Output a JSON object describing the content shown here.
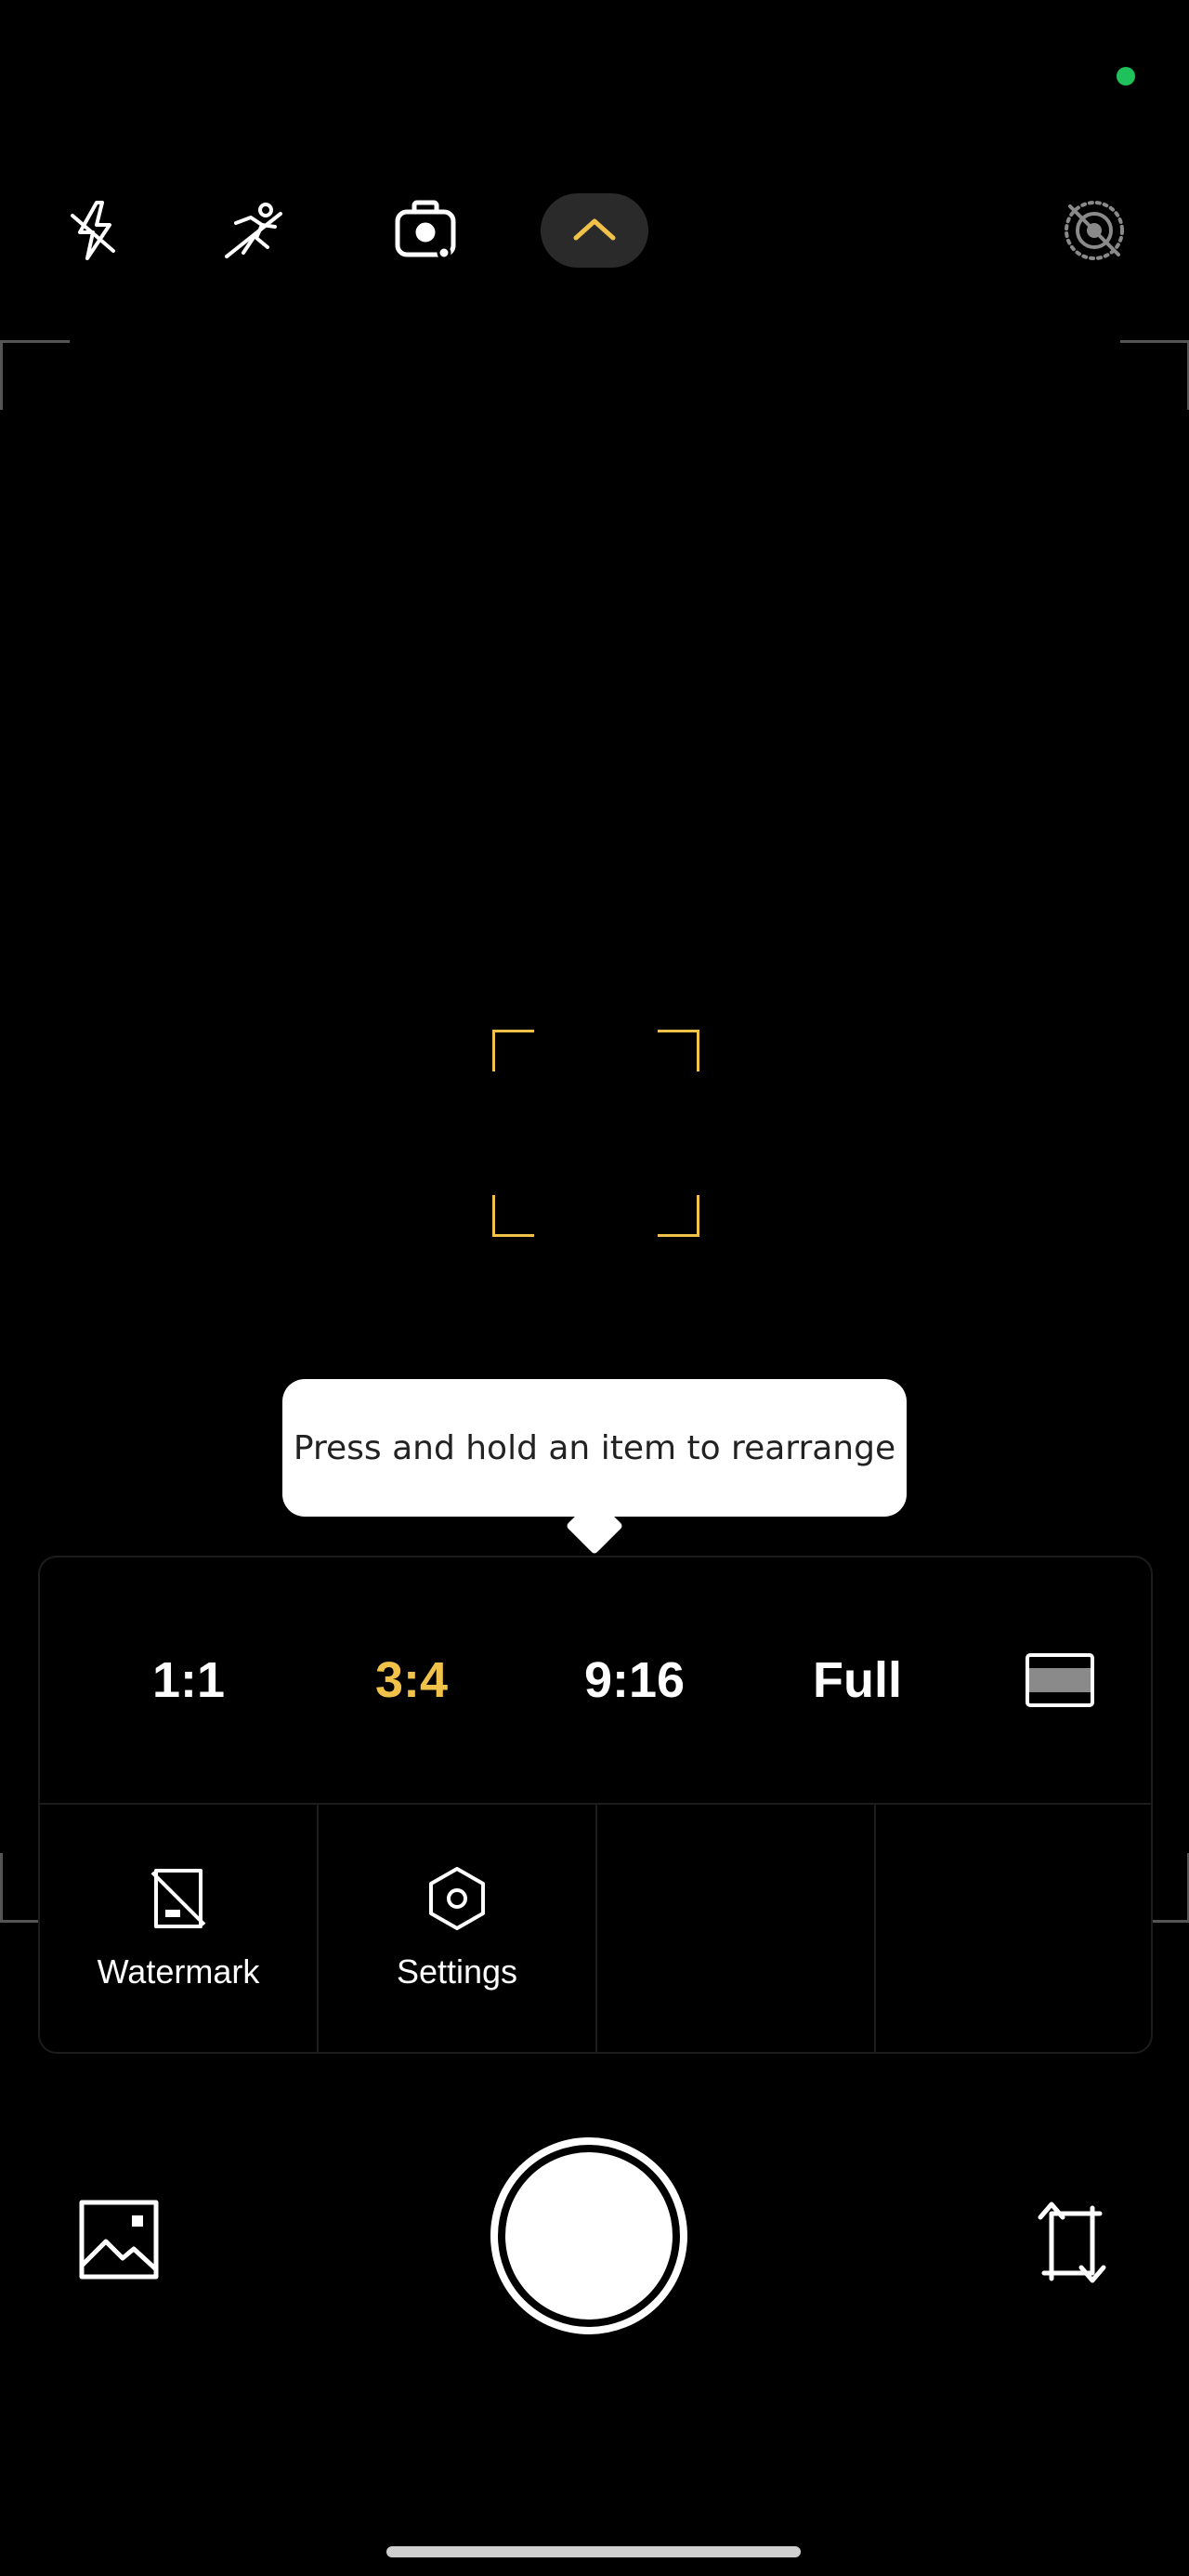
{
  "colors": {
    "accent": "#f1c24a",
    "status_indicator": "#1fc15a",
    "tooltip_bg": "#ffffff",
    "panel_divider": "#1c1c1c"
  },
  "top_bar": {
    "icons": [
      "flash-off-icon",
      "motion-off-icon",
      "camera-mode-icon",
      "chevron-up-icon",
      "live-photo-off-icon"
    ]
  },
  "tooltip": {
    "text": "Press and hold an item to rearrange"
  },
  "aspect_ratios": [
    {
      "label": "1:1",
      "selected": false
    },
    {
      "label": "3:4",
      "selected": true
    },
    {
      "label": "9:16",
      "selected": false
    },
    {
      "label": "Full",
      "selected": false
    }
  ],
  "tools": [
    {
      "label": "Watermark",
      "icon": "watermark-icon"
    },
    {
      "label": "Settings",
      "icon": "settings-icon"
    }
  ],
  "bottom_bar": {
    "icons": [
      "gallery-icon",
      "shutter-button",
      "switch-camera-icon"
    ]
  }
}
